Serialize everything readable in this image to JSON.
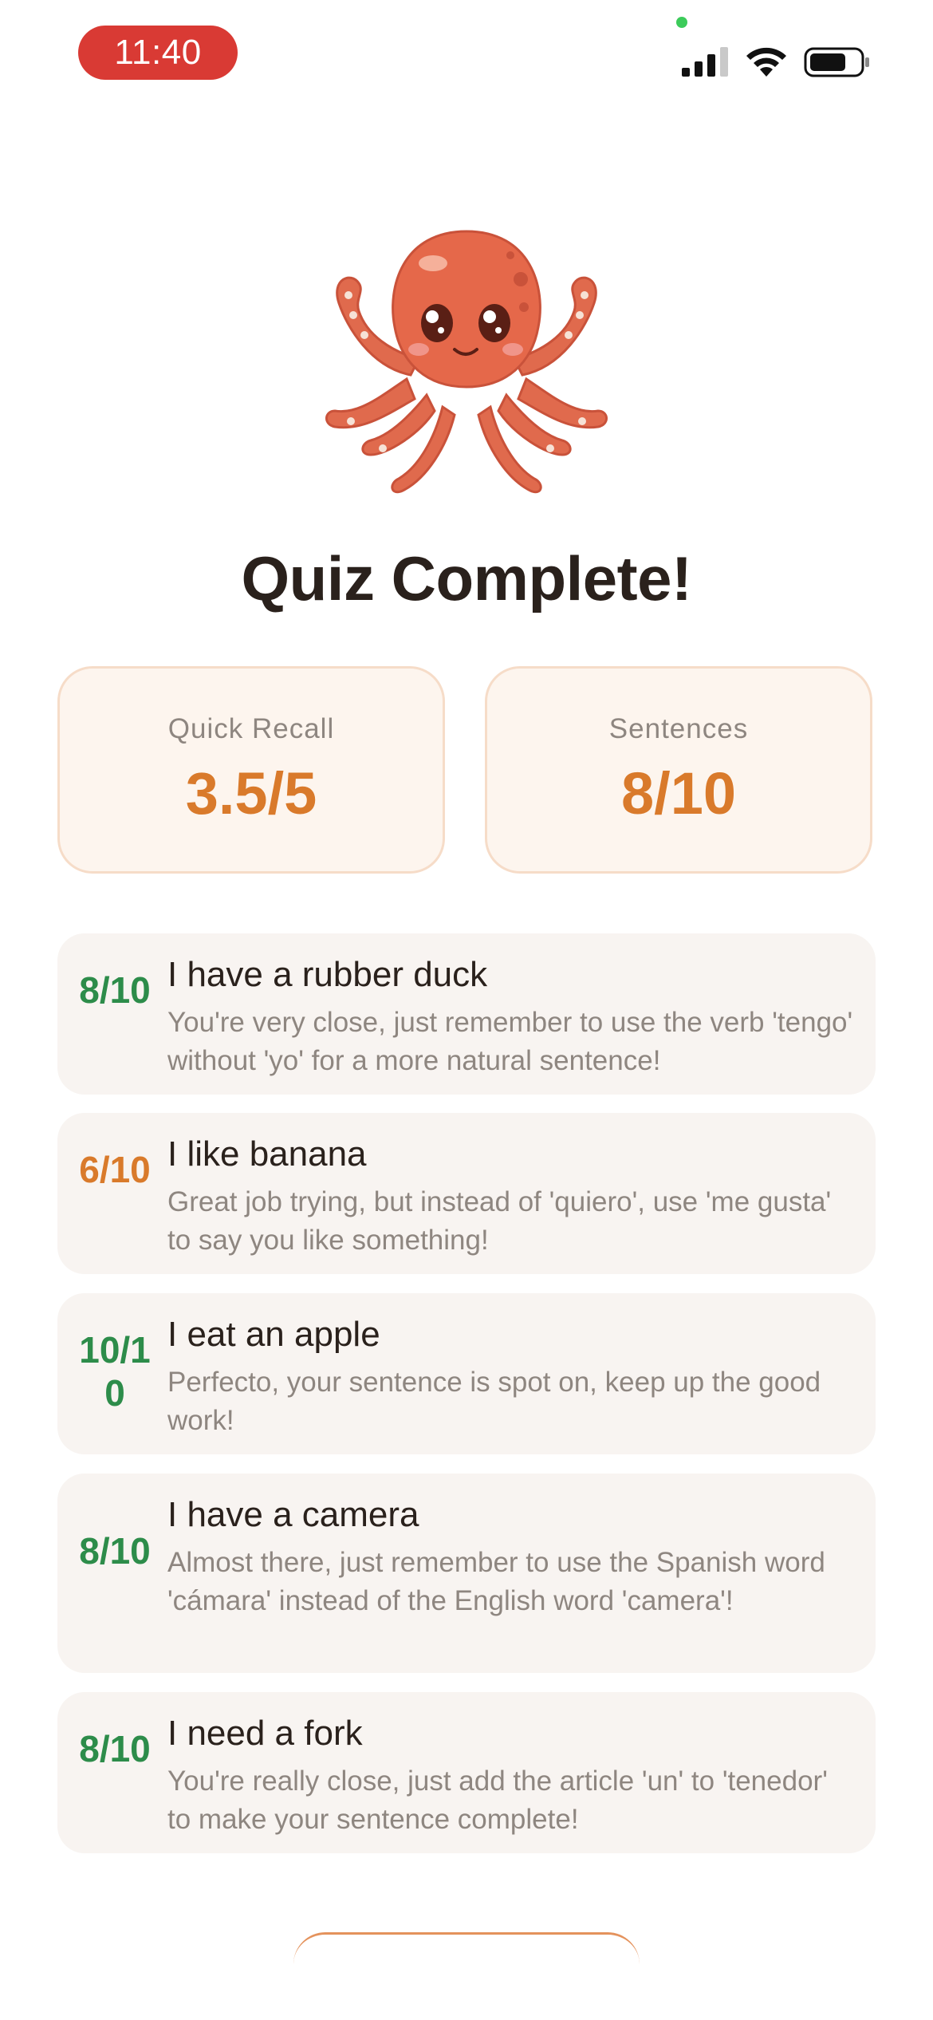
{
  "status_bar": {
    "time": "11:40"
  },
  "mascot": {
    "icon": "octopus-mascot"
  },
  "title": "Quiz Complete!",
  "scores": [
    {
      "label": "Quick Recall",
      "value": "3.5/5"
    },
    {
      "label": "Sentences",
      "value": "8/10"
    }
  ],
  "feedback_items": [
    {
      "score": "8/10",
      "score_color": "#2d8c4a",
      "title": "I have a rubber duck",
      "feedback": "You're very close, just remember to use the verb 'tengo' without 'yo' for a more natural sentence!"
    },
    {
      "score": "6/10",
      "score_color": "#d97a2b",
      "title": "I like banana",
      "feedback": "Great job trying, but instead of 'quiero', use 'me gusta' to say you like something!"
    },
    {
      "score": "10/10",
      "score_color": "#2d8c4a",
      "title": "I eat an apple",
      "feedback": "Perfecto, your sentence is spot on, keep up the good work!"
    },
    {
      "score": "8/10",
      "score_color": "#2d8c4a",
      "title": "I have a camera",
      "feedback": "Almost there, just remember to use the Spanish word 'cámara' instead of the English word 'camera'!"
    },
    {
      "score": "8/10",
      "score_color": "#2d8c4a",
      "title": "I need a fork",
      "feedback": "You're really close, just add the article 'un' to 'tenedor' to make your sentence complete!"
    }
  ],
  "colors": {
    "accent": "#d97a2b",
    "success": "#2d8c4a",
    "time_pill": "#d93a34"
  }
}
